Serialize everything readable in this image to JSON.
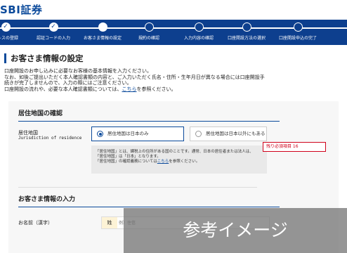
{
  "header": {
    "logo": "SBI証券"
  },
  "steps": [
    {
      "label": "ドレスの登録",
      "state": "done"
    },
    {
      "label": "認証コードの入力",
      "state": "done"
    },
    {
      "label": "お客さま情報の設定",
      "state": "current"
    },
    {
      "label": "規約の確認",
      "state": "todo"
    },
    {
      "label": "入力内容の確認",
      "state": "todo"
    },
    {
      "label": "口座開設方法の選択",
      "state": "todo"
    },
    {
      "label": "口座開設申込の完了",
      "state": "todo"
    }
  ],
  "page": {
    "title": "お客さま情報の設定",
    "intro_1": "口座開設のお申し込みに必要なお客様の基本情報を入力ください。",
    "intro_2": "なお、如後ご提出いただく本人確認書類の内容と、ご入力いただく氏名・住所・生年月日が異なる場合には口座開設手",
    "intro_3": "続きが完了しませんので、入力の際にはご注意ください。",
    "intro_4": "口座開設の流れや、必要な本人確認書類については、",
    "intro_link": "こちら",
    "intro_4_tail": "を参照ください。"
  },
  "residence": {
    "section_title": "居住地国の確認",
    "label_jp": "居住地国",
    "label_en": "Jurisdiction of residence",
    "option_japan": "居住地国は日本のみ",
    "option_other": "居住地国は日本以外にもある",
    "selected": "japan",
    "note_1": "「居住地国」とは、課税上の住所がある国のことです。通常、日本の居住者または法人は、",
    "note_2": "「居住地国」は「日本」となります。",
    "note_3": "「居住地国」の確認義務については",
    "note_link": "こちら",
    "note_3_tail": "を参照ください。"
  },
  "remaining": {
    "text": "残り必須項目 16"
  },
  "customer": {
    "section_title": "お客さま情報の入力",
    "name_label": "お名前（漢字）",
    "sei_label": "姓",
    "sei_placeholder": "例）住信"
  },
  "watermark": {
    "text": "参考イメージ"
  },
  "colors": {
    "brand": "#0b4a9b",
    "stepbar": "#0d3f8e",
    "alert": "#d0021b"
  }
}
